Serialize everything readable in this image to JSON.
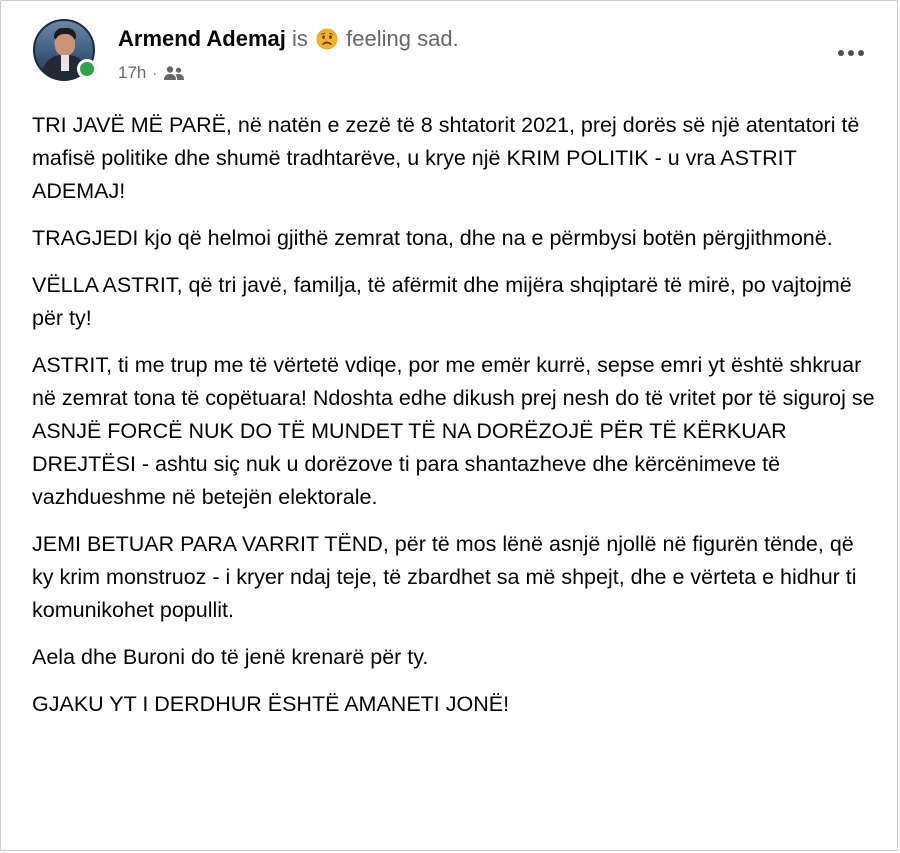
{
  "post": {
    "author": "Armend Ademaj",
    "feeling_prefix": "is",
    "feeling_emoji": "sad-face-emoji",
    "feeling_text": "feeling sad.",
    "timestamp": "17h",
    "separator": "·",
    "audience_icon": "friends-icon",
    "more_icon": "more-options-icon",
    "paragraphs": [
      "TRI JAVË MË PARË, në natën e zezë të 8 shtatorit 2021, prej dorës së një atentatori të mafisë politike dhe shumë tradhtarëve, u krye një KRIM POLITIK - u vra ASTRIT ADEMAJ!",
      "TRAGJEDI kjo që helmoi gjithë zemrat tona, dhe na e përmbysi botën përgjithmonë.",
      "VËLLA ASTRIT, që tri javë, familja, të afërmit dhe mijëra shqiptarë të mirë, po vajtojmë për ty!",
      "ASTRIT, ti me trup me të vërtetë vdiqe, por me emër kurrë, sepse emri yt është shkruar në zemrat tona të copëtuara! Ndoshta edhe dikush prej nesh do të vritet por të siguroj se ASNJË FORCË NUK DO TË MUNDET TË NA DORËZOJË PËR TË KËRKUAR DREJTËSI - ashtu siç nuk u dorëzove ti para shantazheve dhe kërcënimeve të vazhdueshme në betejën elektorale.",
      "JEMI BETUAR PARA VARRIT TËND, për të mos lënë asnjë njollë në figurën tënde, që ky krim monstruoz - i kryer ndaj teje, të zbardhet sa më shpejt, dhe e vërteta e hidhur ti komunikohet popullit.",
      "Aela dhe Buroni do të jenë krenarë për ty.",
      "GJAKU YT I DERDHUR ËSHTË AMANETI JONË!"
    ]
  },
  "colors": {
    "text_primary": "#050505",
    "text_secondary": "#65676b",
    "online_status": "#31a24c",
    "emoji_face": "#f7b125"
  }
}
